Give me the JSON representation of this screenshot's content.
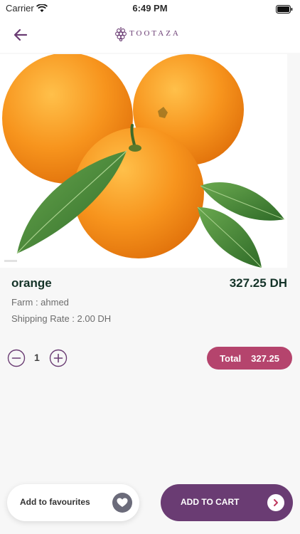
{
  "status_bar": {
    "carrier": "Carrier",
    "time": "6:49 PM"
  },
  "header": {
    "logo_text": "TOOTAZA"
  },
  "product": {
    "name": "orange",
    "price": "327.25 DH",
    "farm": "Farm : ahmed",
    "shipping": "Shipping Rate : 2.00 DH"
  },
  "quantity": {
    "value": "1"
  },
  "total": {
    "label": "Total",
    "value": "327.25"
  },
  "actions": {
    "favourites_label": "Add to favourites",
    "cart_label": "ADD TO CART"
  },
  "colors": {
    "brand_purple": "#6a3c73",
    "total_pink": "#b5446d",
    "heading_green": "#143328"
  },
  "icons": {
    "back": "arrow-left-icon",
    "logo": "grape-logo-icon",
    "minus": "minus-circle-icon",
    "plus": "plus-circle-icon",
    "heart": "heart-icon",
    "cart_arrow": "chevron-right-icon"
  }
}
